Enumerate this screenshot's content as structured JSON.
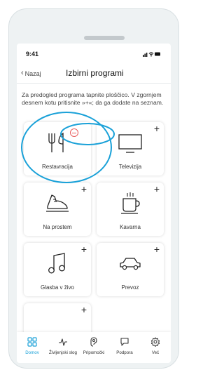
{
  "status": {
    "time": "9:41"
  },
  "nav": {
    "back_label": "Nazaj",
    "title": "Izbirni programi"
  },
  "description": "Za predogled programa tapnite ploščico. V zgornjem desnem kotu pritisnite »+«; da ga dodate na seznam.",
  "tiles": [
    {
      "label": "Restavracija",
      "icon": "restaurant-icon",
      "action": "remove"
    },
    {
      "label": "Televizija",
      "icon": "tv-icon",
      "action": "add"
    },
    {
      "label": "Na prostem",
      "icon": "shoe-icon",
      "action": "add"
    },
    {
      "label": "Kavarna",
      "icon": "coffee-cup-icon",
      "action": "add"
    },
    {
      "label": "Glasba v živo",
      "icon": "music-note-icon",
      "action": "add"
    },
    {
      "label": "Prevoz",
      "icon": "car-icon",
      "action": "add"
    },
    {
      "label": "",
      "icon": "",
      "action": "add"
    }
  ],
  "plus_symbol": "+",
  "tabs": [
    {
      "label": "Domov",
      "icon": "home-grid-icon",
      "active": true
    },
    {
      "label": "Življenjski slog",
      "icon": "lifestyle-pulse-icon",
      "active": false
    },
    {
      "label": "Pripomočki",
      "icon": "hearing-aid-icon",
      "active": false
    },
    {
      "label": "Podpora",
      "icon": "chat-bubble-icon",
      "active": false
    },
    {
      "label": "Več",
      "icon": "gear-icon",
      "active": false
    }
  ],
  "colors": {
    "accent": "#1aa1d8",
    "remove": "#e85a5a",
    "annotation": "#1aa1d8"
  }
}
